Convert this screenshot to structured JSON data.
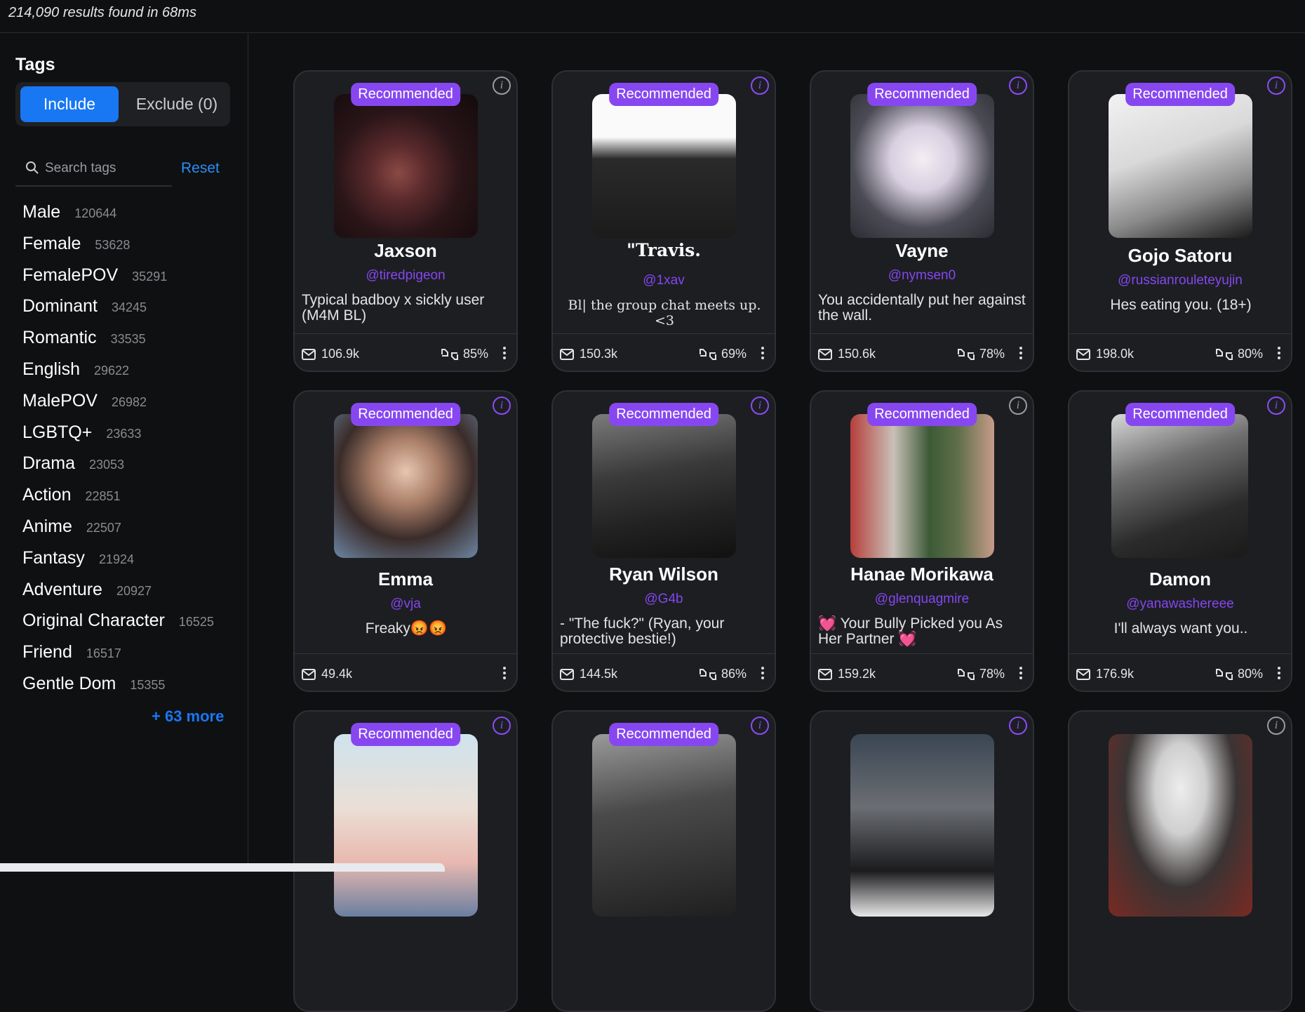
{
  "header": {
    "results_text": "214,090 results found in 68ms"
  },
  "sidebar": {
    "title": "Tags",
    "include_label": "Include",
    "exclude_label": "Exclude (0)",
    "search_placeholder": "Search tags",
    "reset_label": "Reset",
    "tags": [
      {
        "name": "Male",
        "count": "120644"
      },
      {
        "name": "Female",
        "count": "53628"
      },
      {
        "name": "FemalePOV",
        "count": "35291"
      },
      {
        "name": "Dominant",
        "count": "34245"
      },
      {
        "name": "Romantic",
        "count": "33535"
      },
      {
        "name": "English",
        "count": "29622"
      },
      {
        "name": "MalePOV",
        "count": "26982"
      },
      {
        "name": "LGBTQ+",
        "count": "23633"
      },
      {
        "name": "Drama",
        "count": "23053"
      },
      {
        "name": "Action",
        "count": "22851"
      },
      {
        "name": "Anime",
        "count": "22507"
      },
      {
        "name": "Fantasy",
        "count": "21924"
      },
      {
        "name": "Adventure",
        "count": "20927"
      },
      {
        "name": "Original Character",
        "count": "16525"
      },
      {
        "name": "Friend",
        "count": "16517"
      },
      {
        "name": "Gentle Dom",
        "count": "15355"
      }
    ],
    "more_label": "+ 63 more"
  },
  "cards": [
    {
      "badge": "Recommended",
      "name": "Jaxson",
      "handle": "@tiredpigeon",
      "desc": "Typical badboy x sickly user (M4M BL)",
      "messages": "106.9k",
      "rating": "85%"
    },
    {
      "badge": "Recommended",
      "name": "\"Travis.",
      "handle": "@1xav",
      "desc": "Bl| the group chat meets up. <3",
      "messages": "150.3k",
      "rating": "69%"
    },
    {
      "badge": "Recommended",
      "name": "Vayne",
      "handle": "@nymsen0",
      "desc": "You accidentally put her against the wall.",
      "messages": "150.6k",
      "rating": "78%"
    },
    {
      "badge": "Recommended",
      "name": "Gojo Satoru",
      "handle": "@russianrouleteyujin",
      "desc": "Hes eating you. (18+)",
      "messages": "198.0k",
      "rating": "80%"
    },
    {
      "badge": "Recommended",
      "name": "Emma",
      "handle": "@vja",
      "desc": "Freaky😡😡",
      "messages": "49.4k",
      "rating": ""
    },
    {
      "badge": "Recommended",
      "name": "Ryan Wilson",
      "handle": "@G4b",
      "desc": "- \"The fuck?\" (Ryan, your protective bestie!)",
      "messages": "144.5k",
      "rating": "86%"
    },
    {
      "badge": "Recommended",
      "name": "Hanae Morikawa",
      "handle": "@glenquagmire",
      "desc": "💓 Your Bully Picked you As Her Partner 💓",
      "messages": "159.2k",
      "rating": "78%"
    },
    {
      "badge": "Recommended",
      "name": "Damon",
      "handle": "@yanawashereee",
      "desc": "I'll always want you..",
      "messages": "176.9k",
      "rating": "80%"
    },
    {
      "badge": "Recommended"
    },
    {
      "badge": "Recommended"
    },
    {
      "badge": ""
    },
    {
      "badge": ""
    }
  ]
}
